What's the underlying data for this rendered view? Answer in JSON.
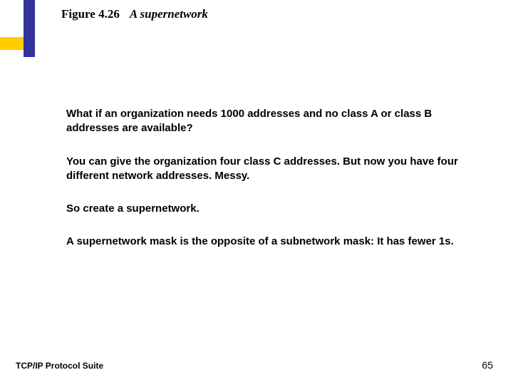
{
  "header": {
    "figure_label": "Figure 4.26",
    "figure_title": "A supernetwork"
  },
  "body": {
    "paragraphs": [
      "What if an organization needs 1000 addresses and no class A or class B addresses are available?",
      "You can give the organization four class C addresses.   But now you have four different network addresses.  Messy.",
      "So create a supernetwork.",
      "A supernetwork mask is the opposite of a subnetwork mask: It has fewer 1s."
    ]
  },
  "footer": {
    "left": "TCP/IP Protocol Suite",
    "page_number": "65"
  }
}
